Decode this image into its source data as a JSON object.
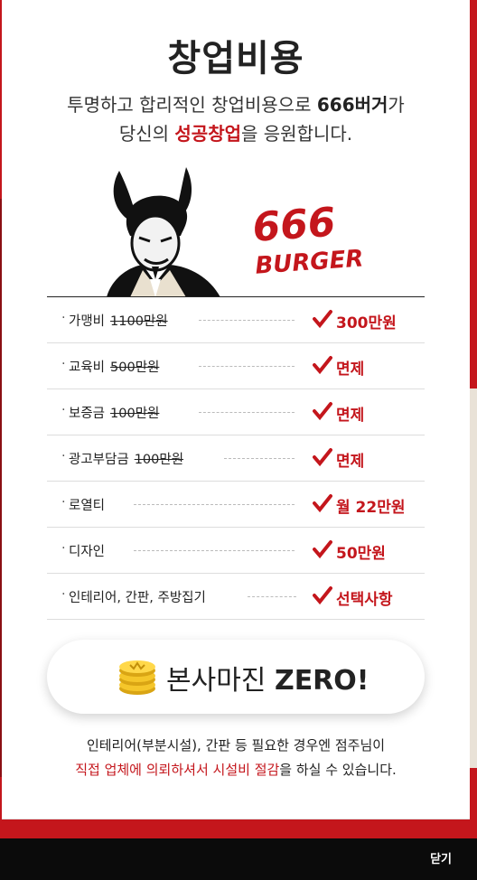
{
  "page": {
    "title": "창업비용",
    "intro": {
      "line1_prefix": "투명하고 합리적인 창업비용으로 ",
      "line1_brand": "666버거",
      "line1_suffix": "가",
      "line2_prefix": "당신의 ",
      "line2_highlight": "성공창업",
      "line2_suffix": "을 응원합니다."
    },
    "logo": {
      "line1": "666",
      "line2": "BURGER"
    }
  },
  "price_list": [
    {
      "label": "가맹비",
      "old": "1100만원",
      "value": "300만원"
    },
    {
      "label": "교육비",
      "old": "500만원",
      "value": "면제"
    },
    {
      "label": "보증금",
      "old": "100만원",
      "value": "면제"
    },
    {
      "label": "광고부담금",
      "old": "100만원",
      "value": "면제"
    },
    {
      "label": "로열티",
      "old": "",
      "value": "월 22만원"
    },
    {
      "label": "디자인",
      "old": "",
      "value": "50만원"
    },
    {
      "label": "인테리어, 간판, 주방집기",
      "old": "",
      "value": "선택사항"
    }
  ],
  "banner": {
    "prefix": "본사마진 ",
    "bold": "ZERO!",
    "icon": "coin-stack-icon"
  },
  "footnote": {
    "line1": "인테리어(부분시설), 간판 등 필요한 경우엔 점주님이",
    "line2_highlight": "직접 업체에 의뢰하셔서 시설비 절감",
    "line2_suffix": "을 하실 수 있습니다."
  },
  "footer": {
    "close_label": "닫기"
  },
  "colors": {
    "accent": "#c4161c",
    "text": "#222222",
    "bottom_bar": "#0b0b0b"
  }
}
